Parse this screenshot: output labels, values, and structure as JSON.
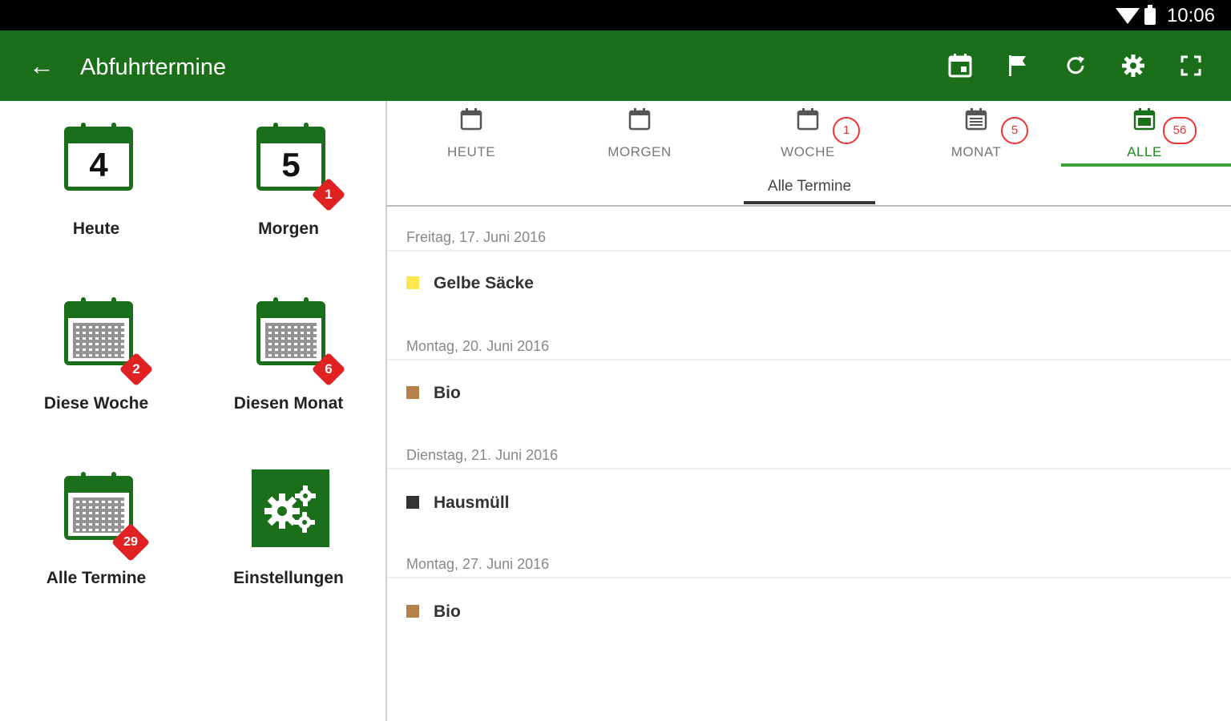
{
  "status_bar": {
    "time": "10:06",
    "wifi_icon": "wifi-icon",
    "battery_icon": "battery-icon"
  },
  "app_bar": {
    "title": "Abfuhrtermine",
    "back_icon": "arrow-left-icon",
    "actions": [
      "calendar-today-icon",
      "flag-icon",
      "refresh-icon",
      "settings-gear-icon",
      "fullscreen-icon"
    ],
    "background": "#1b6f1b"
  },
  "left_tiles": [
    {
      "label": "Heute",
      "day": "4",
      "badge": ""
    },
    {
      "label": "Morgen",
      "day": "5",
      "badge": "1"
    },
    {
      "label": "Diese Woche",
      "badge": "2"
    },
    {
      "label": "Diesen Monat",
      "badge": "6"
    },
    {
      "label": "Alle Termine",
      "badge": "29"
    },
    {
      "label": "Einstellungen",
      "icon": "gears-icon"
    }
  ],
  "tabs": [
    {
      "label": "HEUTE",
      "count": ""
    },
    {
      "label": "MORGEN",
      "count": ""
    },
    {
      "label": "WOCHE",
      "count": "1"
    },
    {
      "label": "MONAT",
      "count": "5"
    },
    {
      "label": "ALLE",
      "count": "56",
      "active": true
    }
  ],
  "subtab": {
    "label": "Alle Termine"
  },
  "schedule": [
    {
      "date": "Freitag, 17. Juni 2016",
      "item": "Gelbe Säcke",
      "color": "#fde74c"
    },
    {
      "date": "Montag, 20. Juni 2016",
      "item": "Bio",
      "color": "#b5804a"
    },
    {
      "date": "Dienstag, 21. Juni 2016",
      "item": "Hausmüll",
      "color": "#333333"
    },
    {
      "date": "Montag, 27. Juni 2016",
      "item": "Bio",
      "color": "#b5804a"
    }
  ]
}
